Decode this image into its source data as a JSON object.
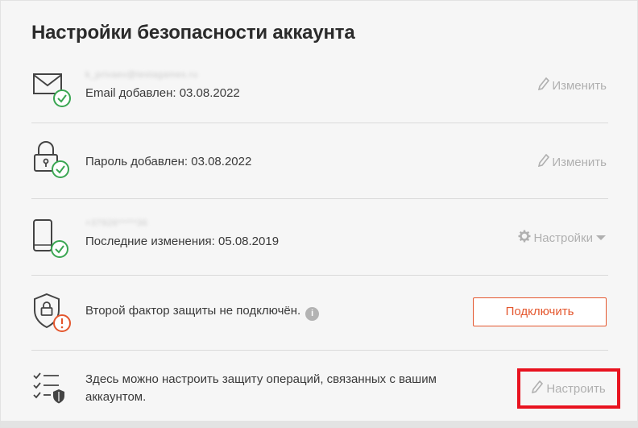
{
  "page": {
    "title": "Настройки безопасности аккаунта"
  },
  "email": {
    "masked_value": "k_privaev@testagames.ru",
    "status_text": "Email добавлен: 03.08.2022",
    "action_label": "Изменить",
    "icon": "envelope-icon"
  },
  "password": {
    "status_text": "Пароль добавлен: 03.08.2022",
    "action_label": "Изменить",
    "icon": "padlock-icon"
  },
  "phone": {
    "masked_value": "+37926*****36",
    "status_text": "Последние изменения: 05.08.2019",
    "action_label": "Настройки",
    "icon": "smartphone-icon"
  },
  "two_factor": {
    "status_text": "Второй фактор защиты не подключён.",
    "info_glyph": "i",
    "button_label": "Подключить",
    "icon": "shield-lock-icon"
  },
  "operations": {
    "text": "Здесь можно настроить защиту операций, связанных с вашим аккаунтом.",
    "button_label": "Настроить",
    "icon": "checklist-shield-icon"
  },
  "colors": {
    "accent": "#e4572e",
    "success": "#3aa652",
    "warning": "#e4572e",
    "highlight_frame": "#e8131f",
    "muted": "#b0b0b0"
  }
}
